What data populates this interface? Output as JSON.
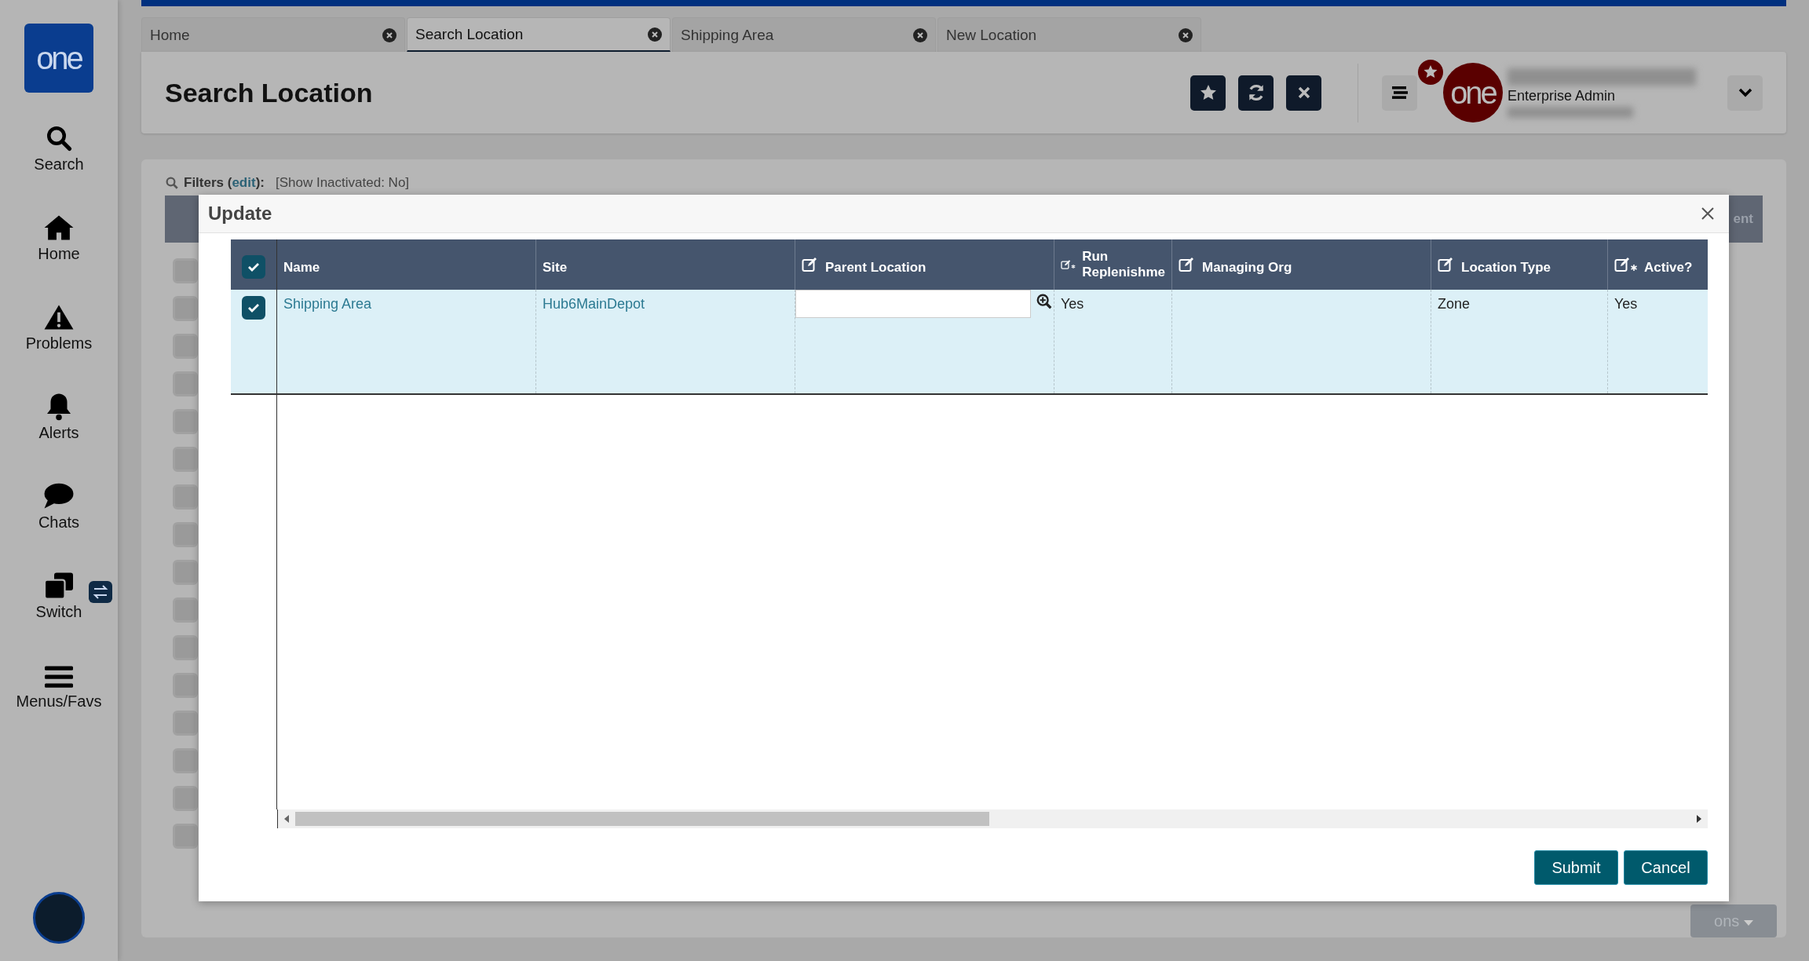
{
  "sidebar": {
    "logo_text": "one",
    "items": [
      {
        "kind": "search",
        "label": "Search"
      },
      {
        "kind": "home",
        "label": "Home"
      },
      {
        "kind": "problems",
        "label": "Problems"
      },
      {
        "kind": "alerts",
        "label": "Alerts"
      },
      {
        "kind": "chats",
        "label": "Chats"
      },
      {
        "kind": "switch",
        "label": "Switch"
      },
      {
        "kind": "menus",
        "label": "Menus/Favs"
      }
    ]
  },
  "tabs": [
    {
      "label": "Home",
      "selected": false
    },
    {
      "label": "Search Location",
      "selected": true
    },
    {
      "label": "Shipping Area",
      "selected": false
    },
    {
      "label": "New Location",
      "selected": false
    }
  ],
  "header": {
    "title": "Search Location",
    "logo_text": "one",
    "user_role": "Enterprise Admin"
  },
  "filters": {
    "label": "Filters (",
    "link": "edit",
    "suffix": "):",
    "summary": "[Show Inactivated: No]"
  },
  "background": {
    "column_fragment": "ent",
    "button_fragment": "ons",
    "rows": [
      {
        "checked": false
      },
      {
        "checked": false
      },
      {
        "checked": false
      },
      {
        "checked": false
      },
      {
        "checked": false
      },
      {
        "checked": false
      },
      {
        "checked": false
      },
      {
        "checked": false
      },
      {
        "checked": false
      },
      {
        "checked": false
      },
      {
        "checked": false
      },
      {
        "checked": false
      },
      {
        "checked": false
      },
      {
        "checked": false
      },
      {
        "checked": false
      },
      {
        "checked": false
      }
    ]
  },
  "modal": {
    "title": "Update",
    "all_checked": true,
    "columns": [
      {
        "label": "Name",
        "kind": "plain"
      },
      {
        "label": "Site",
        "kind": "plain"
      },
      {
        "label": "Parent Location",
        "kind": "editable"
      },
      {
        "label": "Run Replenishme",
        "kind": "required"
      },
      {
        "label": "Managing Org",
        "kind": "editable"
      },
      {
        "label": "Location Type",
        "kind": "editable"
      },
      {
        "label": "Active?",
        "kind": "required"
      }
    ],
    "rows": [
      {
        "selected": true,
        "cells": [
          {
            "kind": "link",
            "text": "Shipping Area"
          },
          {
            "kind": "link",
            "text": "Hub6MainDepot"
          },
          {
            "kind": "lookup"
          },
          {
            "kind": "text",
            "text": "Yes"
          },
          {
            "kind": "empty"
          },
          {
            "kind": "text",
            "text": "Zone"
          },
          {
            "kind": "text",
            "text": "Yes"
          }
        ]
      }
    ],
    "buttons": [
      "Submit",
      "Cancel"
    ]
  }
}
